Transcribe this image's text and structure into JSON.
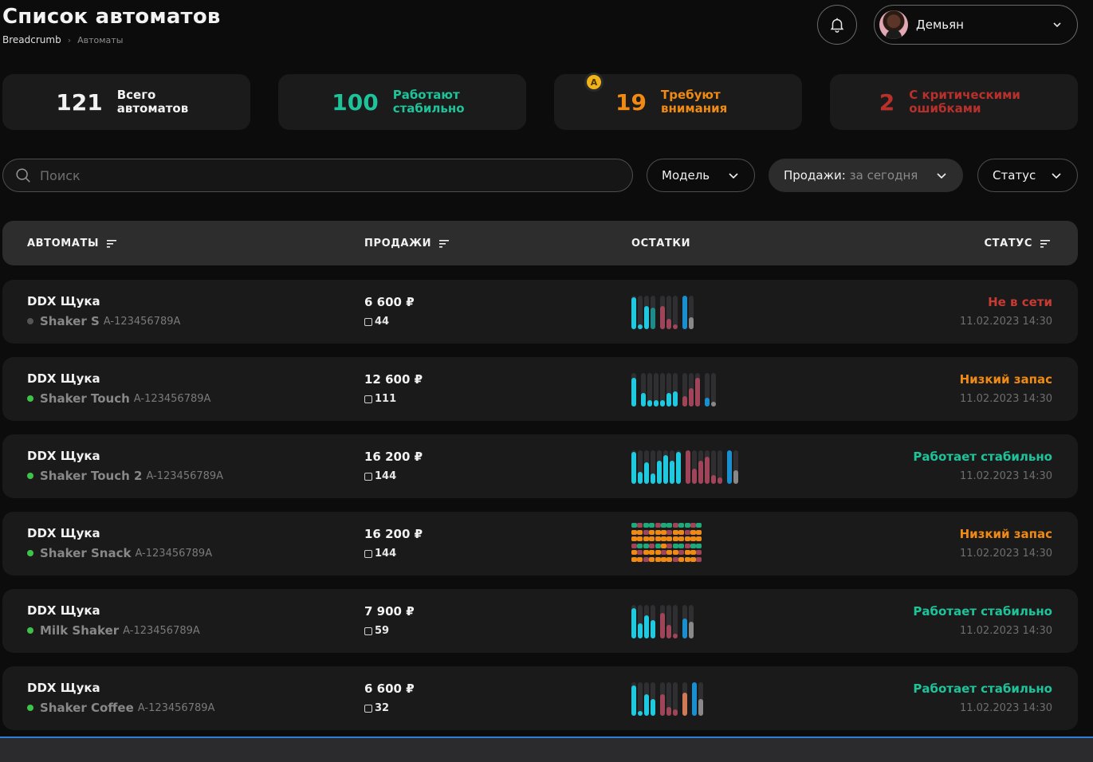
{
  "header": {
    "title": "Список автоматов",
    "breadcrumb": [
      "Breadcrumb",
      "Автоматы"
    ],
    "user_name": "Демьян"
  },
  "stats": [
    {
      "value": "121",
      "label": "Всего автоматов",
      "color": "#f2f2f2"
    },
    {
      "value": "100",
      "label": "Работают стабильно",
      "color": "#1fc39a"
    },
    {
      "value": "19",
      "label": "Требуют внимания",
      "color": "#f08a12",
      "badge": "A"
    },
    {
      "value": "2",
      "label": "С критическими ошибками",
      "color": "#b8302c"
    }
  ],
  "search": {
    "placeholder": "Поиск"
  },
  "filters": {
    "model": "Модель",
    "sales_label": "Продажи:",
    "sales_value": "за сегодня",
    "status": "Статус"
  },
  "table": {
    "headers": {
      "machines": "АВТОМАТЫ",
      "sales": "ПРОДАЖИ",
      "stock": "ОСТАТКИ",
      "status": "СТАТУС"
    },
    "rows": [
      {
        "name": "DDX Щука",
        "model": "Shaker S",
        "serial": "A-123456789A",
        "dot_color": "#555555",
        "sales": "6 600 ₽",
        "count": "44",
        "status": "Не в сети",
        "status_color": "#c83a34",
        "time": "11.02.2023 14:30",
        "stock_type": "bars",
        "bars": [
          [
            0.95,
            "#1fc9e0"
          ],
          [
            0.15,
            "#1fc9e0"
          ],
          [
            0.7,
            "#1fc9e0"
          ],
          [
            0.65,
            "#1f8a8a"
          ],
          [
            0,
            ""
          ],
          [
            0.7,
            "#a0445a"
          ],
          [
            0.3,
            "#a0445a"
          ],
          [
            0.15,
            "#a0445a"
          ],
          [
            0,
            ""
          ],
          [
            1.0,
            "#1a8fd0"
          ],
          [
            0.35,
            "#888888"
          ]
        ]
      },
      {
        "name": "DDX Щука",
        "model": "Shaker Touch",
        "serial": "A-123456789A",
        "dot_color": "#3fc24a",
        "sales": "12 600 ₽",
        "count": "111",
        "status": "Низкий запас",
        "status_color": "#f08a12",
        "time": "11.02.2023 14:30",
        "stock_type": "bars",
        "bars": [
          [
            0.85,
            "#1fc9e0"
          ],
          [
            0,
            ""
          ],
          [
            0.4,
            "#1fc9e0"
          ],
          [
            0.2,
            "#1fc9e0"
          ],
          [
            0.2,
            "#1fc9e0"
          ],
          [
            0.2,
            "#1fc9e0"
          ],
          [
            0.4,
            "#1fc9e0"
          ],
          [
            0.45,
            "#1fc9e0"
          ],
          [
            0,
            ""
          ],
          [
            0.3,
            "#a0445a"
          ],
          [
            0.55,
            "#a0445a"
          ],
          [
            0.85,
            "#a0445a"
          ],
          [
            0,
            ""
          ],
          [
            0.25,
            "#1a8fd0"
          ],
          [
            0.15,
            "#888888"
          ]
        ]
      },
      {
        "name": "DDX Щука",
        "model": "Shaker Touch 2",
        "serial": "A-123456789A",
        "dot_color": "#3fc24a",
        "sales": "16 200 ₽",
        "count": "144",
        "status": "Работает стабильно",
        "status_color": "#1fc39a",
        "time": "11.02.2023 14:30",
        "stock_type": "bars",
        "bars": [
          [
            0.95,
            "#1fc9e0"
          ],
          [
            0.35,
            "#1fc9e0"
          ],
          [
            0.65,
            "#1fc9e0"
          ],
          [
            0.3,
            "#1fc9e0"
          ],
          [
            0.7,
            "#1fc9e0"
          ],
          [
            0.85,
            "#1fc9e0"
          ],
          [
            0.7,
            "#1fc9e0"
          ],
          [
            0.95,
            "#1fc9e0"
          ],
          [
            0,
            ""
          ],
          [
            1.0,
            "#a0445a"
          ],
          [
            0.45,
            "#a0445a"
          ],
          [
            0.7,
            "#a0445a"
          ],
          [
            0.8,
            "#a0445a"
          ],
          [
            0.25,
            "#a0445a"
          ],
          [
            0.2,
            "#a0445a"
          ],
          [
            0,
            ""
          ],
          [
            1.0,
            "#1a8fd0"
          ],
          [
            0.4,
            "#888888"
          ]
        ]
      },
      {
        "name": "DDX Щука",
        "model": "Shaker Snack",
        "serial": "A-123456789A",
        "dot_color": "#3fc24a",
        "sales": "16 200 ₽",
        "count": "144",
        "status": "Низкий запас",
        "status_color": "#f08a12",
        "time": "11.02.2023 14:30",
        "stock_type": "grid",
        "grid": [
          [
            "#1fa87a",
            "#a0445a",
            "#1fa87a",
            "#1fa87a",
            "#a0445a",
            "#1fa87a",
            "#1fa87a",
            "#a0445a",
            "#1fa87a",
            "#1fa87a",
            "#a0445a",
            "#1fa87a"
          ],
          [
            "#f08a12",
            "#f08a12",
            "#a0445a",
            "#f08a12",
            "#f08a12",
            "#f08a12",
            "#a0445a",
            "#f08a12",
            "#f08a12",
            "#a0445a",
            "#f08a12",
            "#f08a12"
          ],
          [
            "#f08a12",
            "#f08a12",
            "#f08a12",
            "#f08a12",
            "#f08a12",
            "#f08a12",
            "#f08a12",
            "#f08a12",
            "#f08a12",
            "#f08a12",
            "#f08a12",
            "#f08a12"
          ],
          [
            "#a0445a",
            "#1fa87a",
            "#1fa87a",
            "#a0445a",
            "#1fa87a",
            "#f08a12",
            "#a0445a",
            "#1fa87a",
            "#1fa87a",
            "#a0445a",
            "#1fa87a",
            "#1fa87a"
          ],
          [
            "#f08a12",
            "#a0445a",
            "#f08a12",
            "#f08a12",
            "#f08a12",
            "#a0445a",
            "#f08a12",
            "#f08a12",
            "#a0445a",
            "#f08a12",
            "#f08a12",
            "#a0445a"
          ],
          [
            "#f08a12",
            "#f08a12",
            "#a0445a",
            "#f08a12",
            "#f08a12",
            "#f08a12",
            "#f08a12",
            "#a0445a",
            "#f08a12",
            "#f08a12",
            "#f08a12",
            "#a0445a"
          ]
        ]
      },
      {
        "name": "DDX Щука",
        "model": "Milk Shaker",
        "serial": "A-123456789A",
        "dot_color": "#3fc24a",
        "sales": "7 900 ₽",
        "count": "59",
        "status": "Работает стабильно",
        "status_color": "#1fc39a",
        "time": "11.02.2023 14:30",
        "stock_type": "bars",
        "bars": [
          [
            0.9,
            "#1fc9e0"
          ],
          [
            0.45,
            "#1fc9e0"
          ],
          [
            0.7,
            "#1fc9e0"
          ],
          [
            0.55,
            "#1fc9e0"
          ],
          [
            0,
            ""
          ],
          [
            0.75,
            "#a0445a"
          ],
          [
            0.4,
            "#a0445a"
          ],
          [
            0.15,
            "#a0445a"
          ],
          [
            0,
            ""
          ],
          [
            0.6,
            "#1a8fd0"
          ],
          [
            0.5,
            "#888888"
          ]
        ]
      },
      {
        "name": "DDX Щука",
        "model": "Shaker Coffee",
        "serial": "A-123456789A",
        "dot_color": "#3fc24a",
        "sales": "6 600 ₽",
        "count": "32",
        "status": "Работает стабильно",
        "status_color": "#1fc39a",
        "time": "11.02.2023 14:30",
        "stock_type": "bars",
        "bars": [
          [
            0.9,
            "#1fc9e0"
          ],
          [
            0.15,
            "#1fc9e0"
          ],
          [
            0.65,
            "#1fc9e0"
          ],
          [
            0.5,
            "#1fc9e0"
          ],
          [
            0,
            ""
          ],
          [
            0.65,
            "#a0445a"
          ],
          [
            0.25,
            "#a0445a"
          ],
          [
            0.2,
            "#a0445a"
          ],
          [
            0,
            ""
          ],
          [
            0.7,
            "#d07a58"
          ],
          [
            0,
            ""
          ],
          [
            1.0,
            "#1a8fd0"
          ],
          [
            0.5,
            "#888888"
          ]
        ]
      }
    ]
  }
}
